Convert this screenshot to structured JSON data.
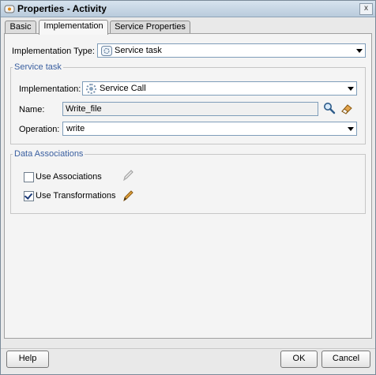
{
  "window": {
    "title": "Properties - Activity",
    "close_glyph": "x"
  },
  "tabs": [
    {
      "label": "Basic"
    },
    {
      "label": "Implementation"
    },
    {
      "label": "Service Properties"
    }
  ],
  "form": {
    "implementation_type_label": "Implementation Type:",
    "implementation_type_value": "Service task",
    "service_task": {
      "legend": "Service task",
      "implementation_label": "Implementation:",
      "implementation_value": "Service Call",
      "name_label": "Name:",
      "name_value": "Write_file",
      "operation_label": "Operation:",
      "operation_value": "write"
    },
    "data_associations": {
      "legend": "Data Associations",
      "use_associations_label": "Use Associations",
      "use_associations_checked": false,
      "use_transformations_label": "Use Transformations",
      "use_transformations_checked": true
    }
  },
  "buttons": {
    "help": "Help",
    "ok": "OK",
    "cancel": "Cancel"
  },
  "icons": [
    "activity-icon",
    "gear-icon",
    "search-icon",
    "eraser-icon",
    "pencil-icon",
    "checkbox-icon"
  ],
  "colors": {
    "title_bar": "#c7d6e5",
    "legend_text": "#3a5fa0",
    "pencil_active": "#d08a14"
  }
}
